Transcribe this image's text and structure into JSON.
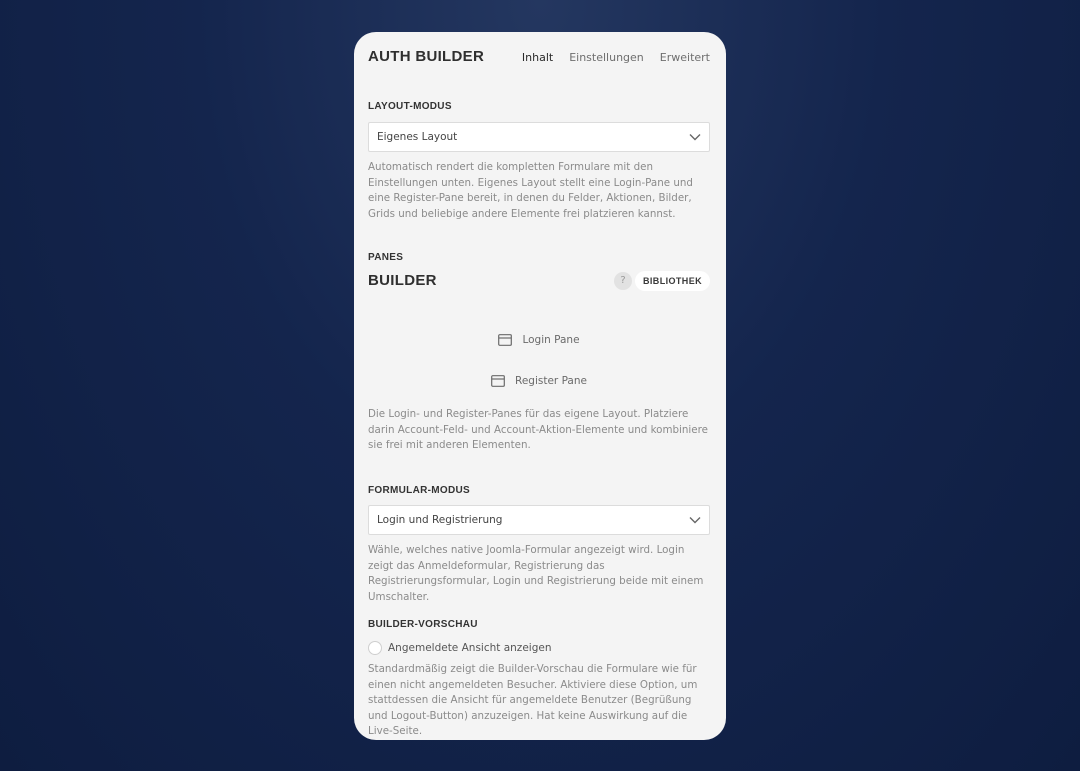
{
  "header": {
    "title": "AUTH BUILDER",
    "tabs": [
      {
        "label": "Inhalt",
        "active": true
      },
      {
        "label": "Einstellungen",
        "active": false
      },
      {
        "label": "Erweitert",
        "active": false
      }
    ]
  },
  "layout_mode": {
    "label": "LAYOUT-MODUS",
    "selected": "Eigenes Layout",
    "help": "Automatisch rendert die kompletten Formulare mit den Einstellungen unten. Eigenes Layout stellt eine Login-Pane und eine Register-Pane bereit, in denen du Felder, Aktionen, Bilder, Grids und beliebige andere Elemente frei platzieren kannst."
  },
  "panes": {
    "label": "PANES",
    "builder_title": "BUILDER",
    "help_icon": "question-icon",
    "library_button": "BIBLIOTHEK",
    "items": [
      {
        "label": "Login Pane",
        "icon": "window-icon"
      },
      {
        "label": "Register Pane",
        "icon": "window-icon"
      }
    ],
    "help": "Die Login- und Register-Panes für das eigene Layout. Platziere darin Account-Feld- und Account-Aktion-Elemente und kombiniere sie frei mit anderen Elementen."
  },
  "form_mode": {
    "label": "FORMULAR-MODUS",
    "selected": "Login und Registrierung",
    "help": "Wähle, welches native Joomla-Formular angezeigt wird. Login zeigt das Anmeldeformular, Registrierung das Registrierungsformular, Login und Registrierung beide mit einem Umschalter."
  },
  "builder_preview": {
    "label": "BUILDER-VORSCHAU",
    "option_label": "Angemeldete Ansicht anzeigen",
    "checked": false,
    "help": "Standardmäßig zeigt die Builder-Vorschau die Formulare wie für einen nicht angemeldeten Besucher. Aktiviere diese Option, um stattdessen die Ansicht für angemeldete Benutzer (Begrüßung und Logout-Button) anzuzeigen. Hat keine Auswirkung auf die Live-Seite."
  },
  "colors": {
    "panel_bg": "#f4f4f4",
    "background": "#14254d"
  }
}
